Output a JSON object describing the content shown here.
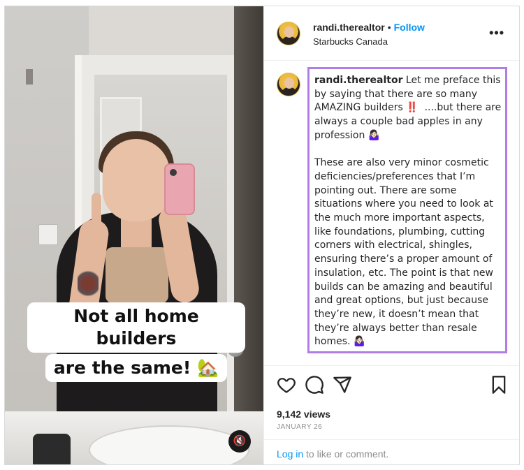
{
  "media": {
    "caption_line1": "Not all home builders",
    "caption_line2": "are the same! 🏡",
    "mute_icon": "🔇"
  },
  "header": {
    "username": "randi.therealtor",
    "separator": "•",
    "follow_label": "Follow",
    "location": "Starbucks Canada",
    "more_icon": "•••"
  },
  "comment": {
    "username": "randi.therealtor",
    "text": " Let me preface this by saying that there are so many AMAZING builders ‼️  ....but there are always a couple bad apples in any profession 🤷🏻‍♀️\n\nThese are also very minor cosmetic deficiencies/preferences that I’m pointing out. There are some situations where you need to look at the much more important aspects, like foundations, plumbing, cutting corners with electrical, shingles, ensuring there’s a proper amount of insulation, etc. The point is that new builds can be amazing and beautiful and great options, but just because they’re new, it doesn’t mean that they’re always better than resale homes. 🤷🏻‍♀️"
  },
  "stats": {
    "views": "9,142 views",
    "date": "JANUARY 26"
  },
  "login": {
    "link": "Log in",
    "rest": " to like or comment."
  },
  "colors": {
    "accent": "#0095f6",
    "highlight_border": "#b07de6"
  }
}
